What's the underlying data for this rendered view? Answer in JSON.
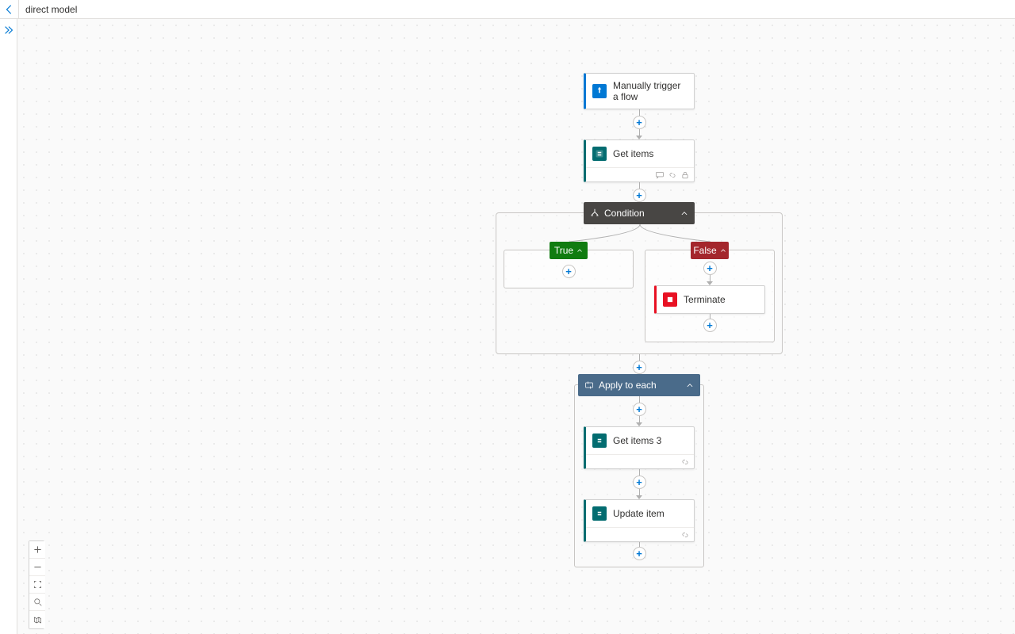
{
  "header": {
    "title": "direct model"
  },
  "flow": {
    "trigger": {
      "label": "Manually trigger a flow",
      "accent": "#0078d4",
      "icon_bg": "#0078d4"
    },
    "get_items": {
      "label": "Get items",
      "accent": "#036c70",
      "icon_bg": "#036c70"
    },
    "condition": {
      "label": "Condition",
      "true_label": "True",
      "false_label": "False",
      "terminate": {
        "label": "Terminate",
        "accent": "#e81123",
        "icon_bg": "#e81123"
      }
    },
    "apply_each": {
      "label": "Apply to each",
      "get_items3": {
        "label": "Get items 3",
        "accent": "#036c70",
        "icon_bg": "#036c70"
      },
      "update_item": {
        "label": "Update item",
        "accent": "#036c70",
        "icon_bg": "#036c70"
      }
    }
  }
}
